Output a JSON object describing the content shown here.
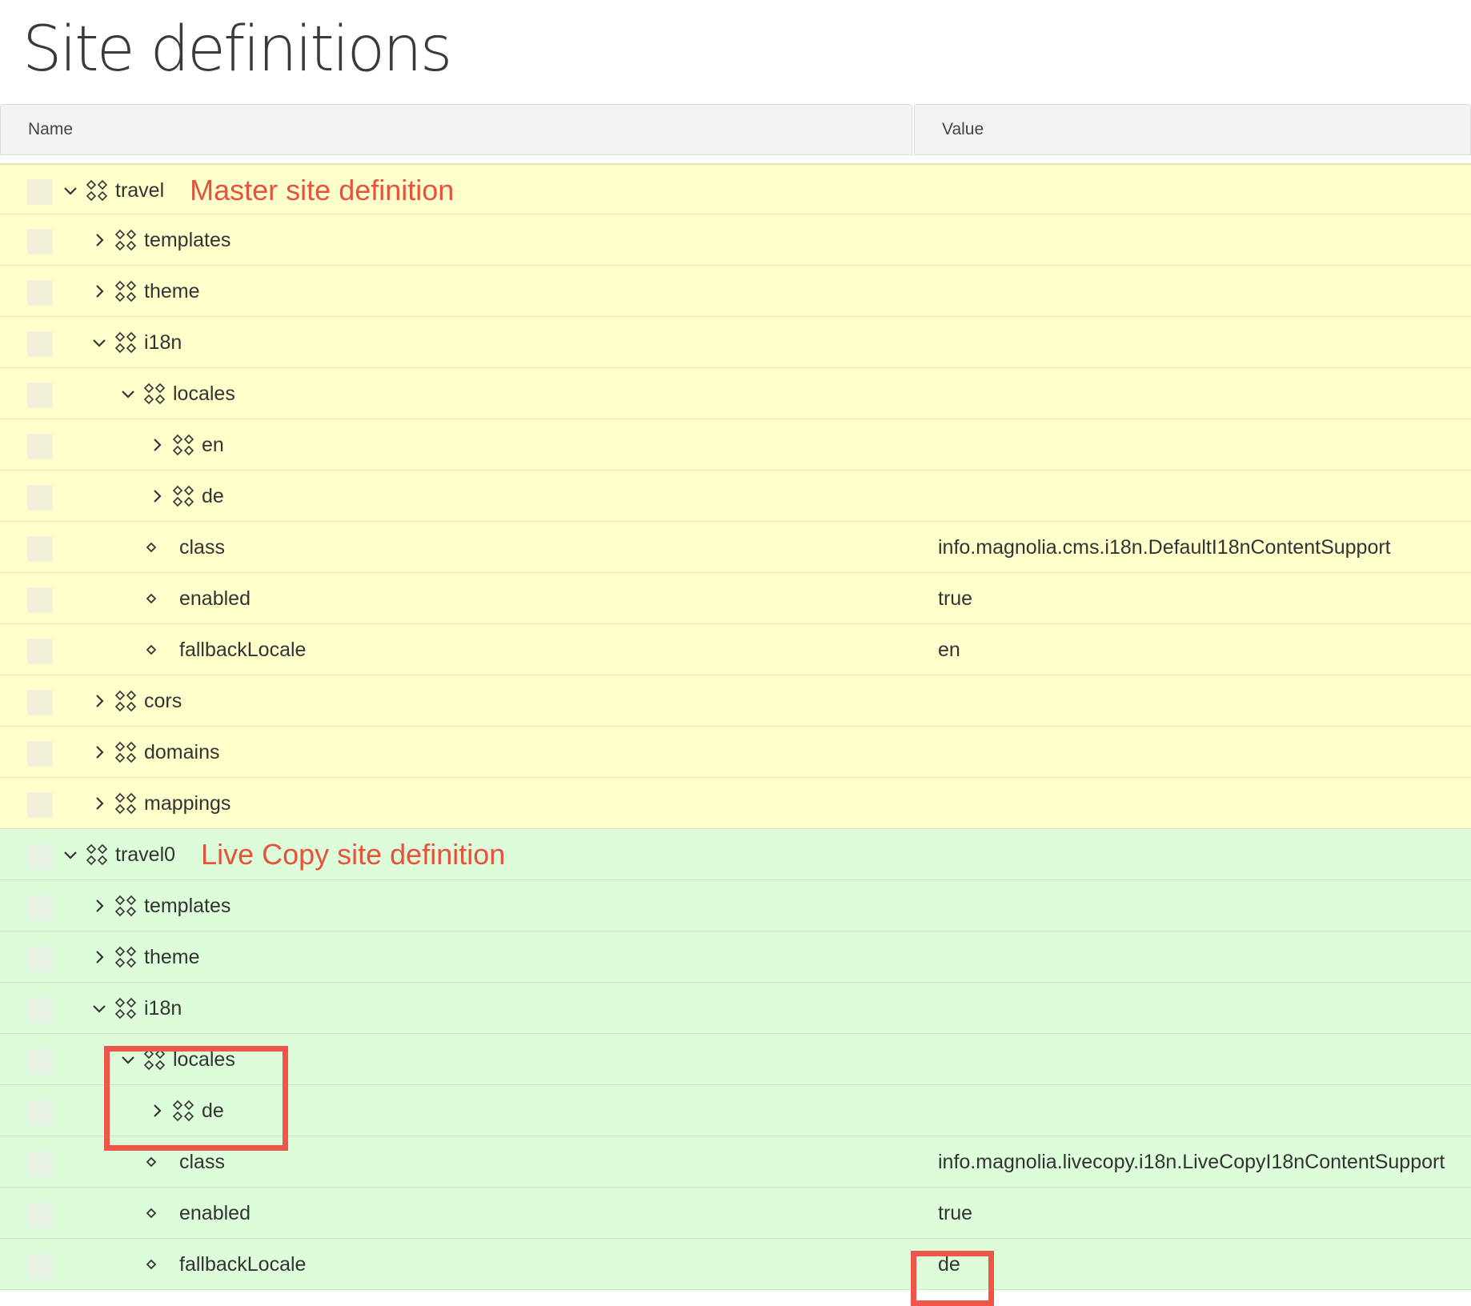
{
  "page": {
    "title": "Site definitions"
  },
  "columns": {
    "name": "Name",
    "value": "Value"
  },
  "annotations": {
    "master": "Master site definition",
    "live": "Live Copy site definition"
  },
  "colors": {
    "master_bg": "#ffffcc",
    "live_bg": "#ddfcd9",
    "annotation": "#e5533d",
    "highlight_box": "#f0554a"
  },
  "rows": [
    {
      "name": "travel",
      "value": "",
      "depth": 0,
      "kind": "node",
      "expand": "expanded",
      "group": "master",
      "annotation": "master"
    },
    {
      "name": "templates",
      "value": "",
      "depth": 1,
      "kind": "node",
      "expand": "collapsed",
      "group": "master"
    },
    {
      "name": "theme",
      "value": "",
      "depth": 1,
      "kind": "node",
      "expand": "collapsed",
      "group": "master"
    },
    {
      "name": "i18n",
      "value": "",
      "depth": 1,
      "kind": "node",
      "expand": "expanded",
      "group": "master"
    },
    {
      "name": "locales",
      "value": "",
      "depth": 2,
      "kind": "node",
      "expand": "expanded",
      "group": "master"
    },
    {
      "name": "en",
      "value": "",
      "depth": 3,
      "kind": "node",
      "expand": "collapsed",
      "group": "master"
    },
    {
      "name": "de",
      "value": "",
      "depth": 3,
      "kind": "node",
      "expand": "collapsed",
      "group": "master"
    },
    {
      "name": "class",
      "value": "info.magnolia.cms.i18n.DefaultI18nContentSupport",
      "depth": 2,
      "kind": "property",
      "group": "master"
    },
    {
      "name": "enabled",
      "value": "true",
      "depth": 2,
      "kind": "property",
      "group": "master"
    },
    {
      "name": "fallbackLocale",
      "value": "en",
      "depth": 2,
      "kind": "property",
      "group": "master"
    },
    {
      "name": "cors",
      "value": "",
      "depth": 1,
      "kind": "node",
      "expand": "collapsed",
      "group": "master"
    },
    {
      "name": "domains",
      "value": "",
      "depth": 1,
      "kind": "node",
      "expand": "collapsed",
      "group": "master"
    },
    {
      "name": "mappings",
      "value": "",
      "depth": 1,
      "kind": "node",
      "expand": "collapsed",
      "group": "master"
    },
    {
      "name": "travel0",
      "value": "",
      "depth": 0,
      "kind": "node",
      "expand": "expanded",
      "group": "live",
      "annotation": "live"
    },
    {
      "name": "templates",
      "value": "",
      "depth": 1,
      "kind": "node",
      "expand": "collapsed",
      "group": "live"
    },
    {
      "name": "theme",
      "value": "",
      "depth": 1,
      "kind": "node",
      "expand": "collapsed",
      "group": "live"
    },
    {
      "name": "i18n",
      "value": "",
      "depth": 1,
      "kind": "node",
      "expand": "expanded",
      "group": "live"
    },
    {
      "name": "locales",
      "value": "",
      "depth": 2,
      "kind": "node",
      "expand": "expanded",
      "group": "live"
    },
    {
      "name": "de",
      "value": "",
      "depth": 3,
      "kind": "node",
      "expand": "collapsed",
      "group": "live"
    },
    {
      "name": "class",
      "value": "info.magnolia.livecopy.i18n.LiveCopyI18nContentSupport",
      "depth": 2,
      "kind": "property",
      "group": "live"
    },
    {
      "name": "enabled",
      "value": "true",
      "depth": 2,
      "kind": "property",
      "group": "live"
    },
    {
      "name": "fallbackLocale",
      "value": "de",
      "depth": 2,
      "kind": "property",
      "group": "live"
    }
  ]
}
